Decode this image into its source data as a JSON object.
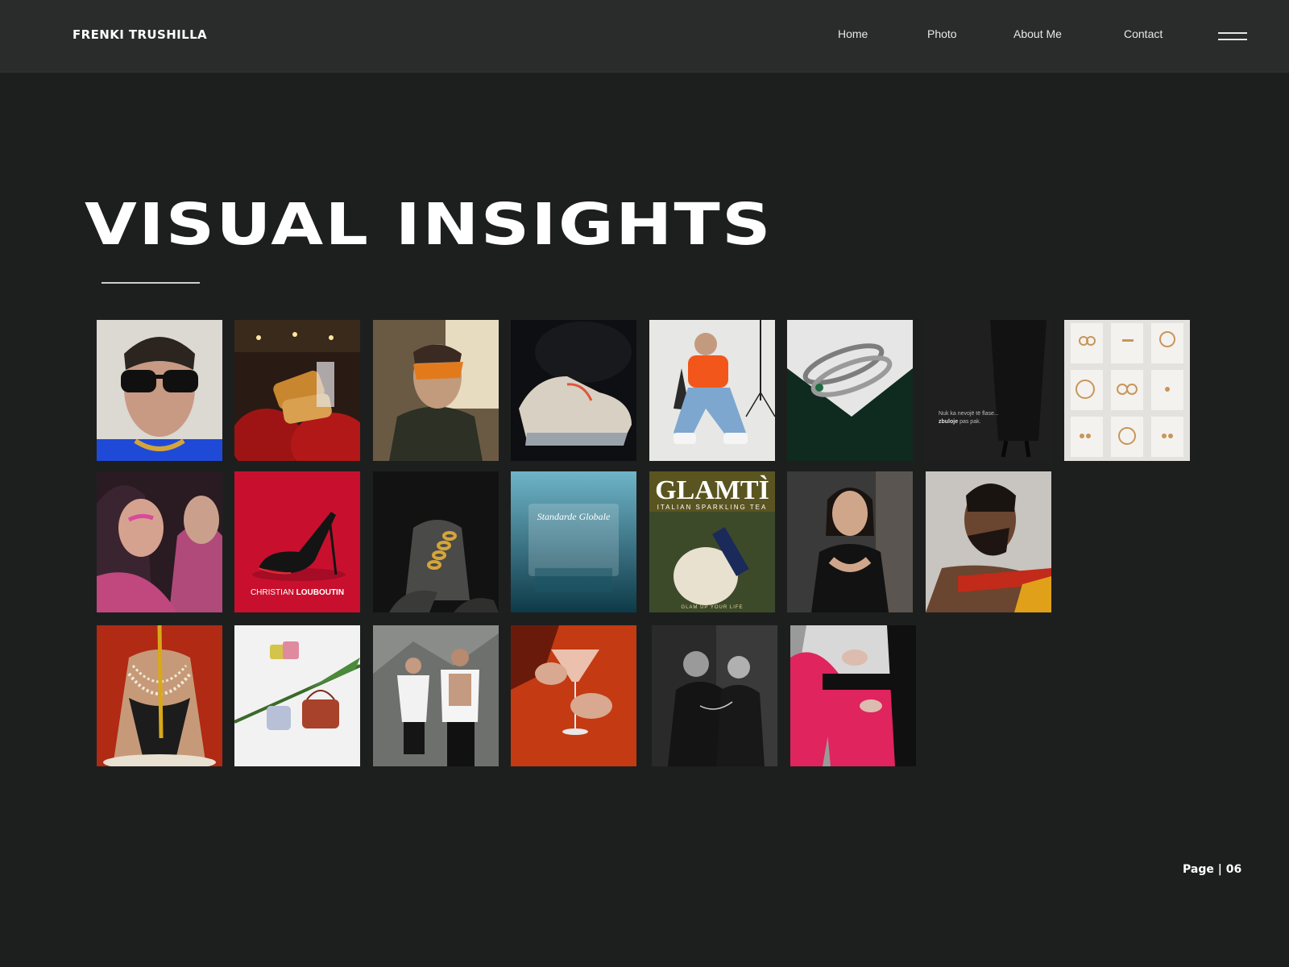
{
  "header": {
    "brand": "FRENKI TRUSHILLA",
    "nav": [
      "Home",
      "Photo",
      "About Me",
      "Contact"
    ],
    "menu_icon": "hamburger-menu-icon"
  },
  "main": {
    "headline": "VISUAL INSIGHTS",
    "tile_texts": {
      "louboutin_light": "CHRISTIAN ",
      "louboutin_bold": "LOUBOUTIN",
      "quote_line1": "Nuk ka nevojë të flase...",
      "quote_line2_bold": "zbuloje",
      "quote_line2_rest": " pas pak.",
      "standarde": "Standarde Globale",
      "glamti_title": "GLAMTÌ",
      "glamti_sub": "ITALIAN SPARKLING TEA",
      "glamti_footer": "GLAM UP YOUR LIFE"
    }
  },
  "footer": {
    "page_label": "Page | 06"
  },
  "colors": {
    "background": "#1d1f1f",
    "topbar": "#2a2b2b",
    "text": "#ffffff",
    "louboutin_red": "#c8102e",
    "hot_pink": "#e0245e"
  }
}
